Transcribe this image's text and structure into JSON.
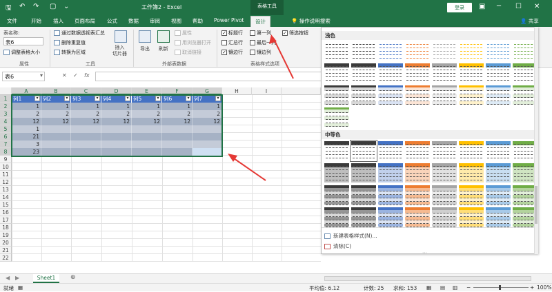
{
  "titlebar": {
    "title": "工作簿2 - Excel",
    "context_tab": "表格工具",
    "login": "登录",
    "share": "共享"
  },
  "tabs": [
    "文件",
    "开始",
    "插入",
    "页面布局",
    "公式",
    "数据",
    "审阅",
    "视图",
    "帮助",
    "Power Pivot",
    "设计",
    "操作说明搜索"
  ],
  "active_tab": "设计",
  "ribbon": {
    "properties": {
      "table_name_label": "表名称:",
      "table_name_value": "表6",
      "resize": "调整表格大小",
      "group": "属性"
    },
    "tools": {
      "pivot": "通过数据透视表汇总",
      "remove_dup": "删除重复值",
      "convert": "转换为区域",
      "slicer": "插入\n切片器",
      "group": "工具"
    },
    "external": {
      "export": "导出",
      "refresh": "刷新",
      "properties": "属性",
      "open_browser": "用浏览器打开",
      "unlink": "取消链接",
      "group": "外部表数据"
    },
    "style_options": {
      "header_row": "标题行",
      "first_col": "第一列",
      "filter_btn": "筛选按钮",
      "total_row": "汇总行",
      "last_col": "最后一列",
      "banded_rows": "镶边行",
      "banded_cols": "镶边列",
      "group": "表格样式选项"
    }
  },
  "formula_bar": {
    "name_box": "表6",
    "fx": "fx"
  },
  "columns": [
    "A",
    "B",
    "C",
    "D",
    "E",
    "F",
    "G",
    "H",
    "I"
  ],
  "rows": [
    "1",
    "2",
    "3",
    "4",
    "5",
    "6",
    "7",
    "8",
    "9",
    "10",
    "11",
    "12",
    "13",
    "14",
    "15",
    "16",
    "17",
    "18",
    "19",
    "20",
    "21",
    "22"
  ],
  "table": {
    "headers": [
      "列1",
      "列2",
      "列3",
      "列4",
      "列5",
      "列6",
      "列7"
    ],
    "data": [
      [
        "1",
        "1",
        "1",
        "1",
        "1",
        "1",
        "1"
      ],
      [
        "2",
        "2",
        "2",
        "2",
        "2",
        "2",
        "2"
      ],
      [
        "12",
        "12",
        "12",
        "12",
        "12",
        "12",
        "12"
      ],
      [
        "1",
        "",
        "",
        "",
        "",
        "",
        ""
      ],
      [
        "21",
        "",
        "",
        "",
        "",
        "",
        ""
      ],
      [
        "3",
        "",
        "",
        "",
        "",
        "",
        ""
      ],
      [
        "23",
        "",
        "",
        "",
        "",
        "",
        ""
      ]
    ]
  },
  "gallery": {
    "light": "浅色",
    "medium": "中等色",
    "new_style": "新建表格样式(N)...",
    "clear": "清除(C)",
    "colors": {
      "black": "#3b3b3b",
      "blue": "#4472c4",
      "orange": "#ed7d31",
      "gray": "#a5a5a5",
      "gold": "#ffc000",
      "lightblue": "#5b9bd5",
      "green": "#70ad47"
    }
  },
  "sheet_tab": "Sheet1",
  "status": {
    "ready": "就绪",
    "average": "平均值: 6.12",
    "count": "计数: 25",
    "sum": "求和: 153",
    "zoom": "100%"
  }
}
